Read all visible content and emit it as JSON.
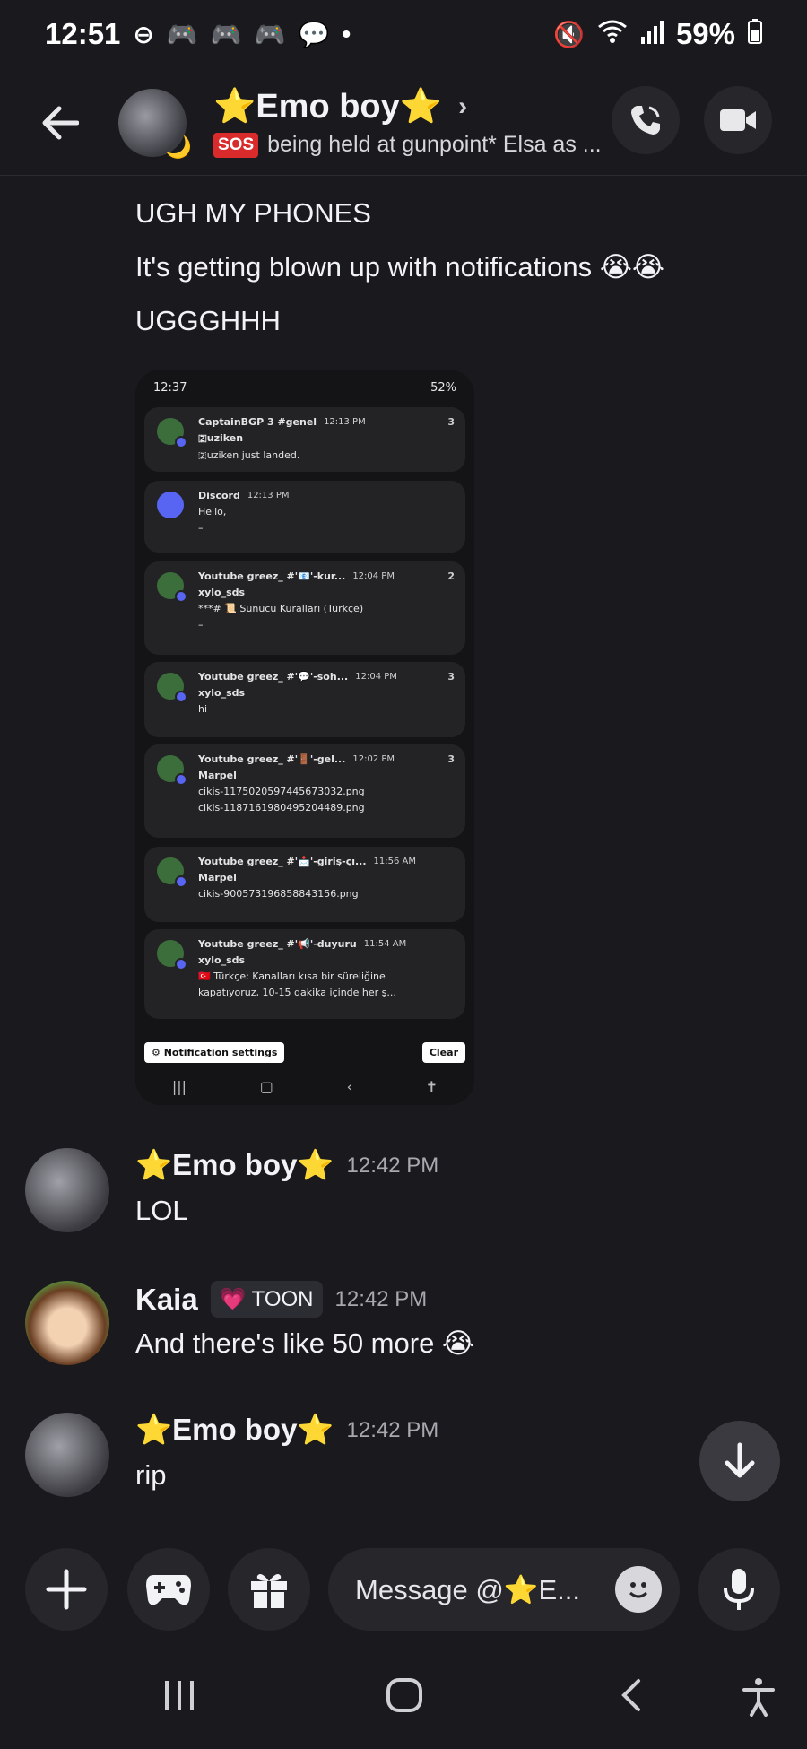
{
  "status_bar": {
    "time": "12:51",
    "battery": "59%",
    "left_icons": [
      "dnd-icon",
      "game-icon",
      "game-icon",
      "game-icon",
      "chat-icon",
      "dot-icon"
    ],
    "right_icons": [
      "mute-icon",
      "wifi-icon",
      "signal-icon",
      "battery-icon"
    ]
  },
  "header": {
    "title": "⭐Emo boy⭐",
    "status_badge": "SOS",
    "status_text": "being held at gunpoint* Elsa as ..."
  },
  "messages_top": {
    "line1": "UGH MY PHONES",
    "line2": "It's getting blown up with notifications 😭😭",
    "line3": "UGGGHHH"
  },
  "attachment": {
    "status_time": "12:37",
    "status_right": "52%",
    "notifications": [
      {
        "title": "CaptainBGP 3 #genel",
        "time": "12:13 PM",
        "count": "3",
        "lines": [
          "🇿uziken",
          "🇿uziken just landed."
        ]
      },
      {
        "title": "Discord",
        "time": "12:13 PM",
        "count": "",
        "lines": [
          "Hello,",
          "–"
        ]
      },
      {
        "title": "Youtube greez_ #'📧'-kur...",
        "time": "12:04 PM",
        "count": "2",
        "lines": [
          "xylo_sds",
          "***# 📜 Sunucu Kuralları (Türkçe)",
          "–"
        ]
      },
      {
        "title": "Youtube greez_ #'💬'-soh...",
        "time": "12:04 PM",
        "count": "3",
        "lines": [
          "xylo_sds",
          "hi"
        ]
      },
      {
        "title": "Youtube greez_ #'🚪'-gel...",
        "time": "12:02 PM",
        "count": "3",
        "lines": [
          "Marpel",
          "cikis-1175020597445673032.png",
          "cikis-1187161980495204489.png"
        ]
      },
      {
        "title": "Youtube greez_ #'📩'-giriş-çı...",
        "time": "11:56 AM",
        "count": "",
        "lines": [
          "Marpel",
          "cikis-900573196858843156.png"
        ]
      },
      {
        "title": "Youtube greez_ #'📢'-duyuru",
        "time": "11:54 AM",
        "count": "",
        "lines": [
          "xylo_sds",
          "🇹🇷 Türkçe: Kanalları kısa bir süreliğine",
          "kapatıyoruz, 10-15 dakika içinde her ş..."
        ]
      }
    ],
    "settings_label": "⚙ Notification settings",
    "clear_label": "Clear"
  },
  "messages": [
    {
      "name": "⭐Emo boy⭐",
      "time": "12:42 PM",
      "text": "LOL"
    },
    {
      "name": "Kaia",
      "tag": "TOON",
      "time": "12:42 PM",
      "text": "And there's like 50 more 😭"
    },
    {
      "name": "⭐Emo boy⭐",
      "time": "12:42 PM",
      "text": "rip"
    }
  ],
  "input": {
    "placeholder": "Message @⭐E..."
  }
}
